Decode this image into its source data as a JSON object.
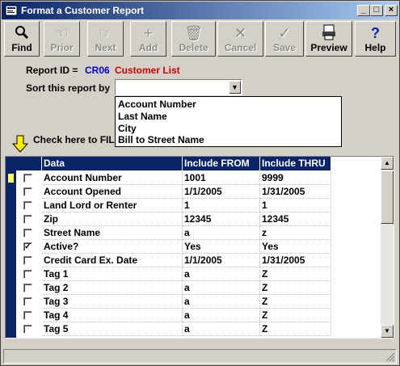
{
  "window": {
    "title": "Format a Customer Report"
  },
  "toolbar": {
    "find": "Find",
    "prior": "Prior",
    "next": "Next",
    "add": "Add",
    "delete": "Delete",
    "cancel": "Cancel",
    "save": "Save",
    "preview": "Preview",
    "help": "Help"
  },
  "report": {
    "id_label": "Report ID =",
    "id_value": "CR06",
    "name": "Customer List"
  },
  "sort": {
    "label": "Sort this report by",
    "selected": "",
    "options": [
      "Account Number",
      "Last Name",
      "City",
      "Bill to Street Name"
    ]
  },
  "filter": {
    "label": "Check here to FIL"
  },
  "grid": {
    "headers": [
      "Data",
      "Include FROM",
      "Include THRU"
    ],
    "rows": [
      {
        "checked": false,
        "data": "Account Number",
        "from": "1001",
        "thru": "9999"
      },
      {
        "checked": false,
        "data": "Account Opened",
        "from": "1/1/2005",
        "thru": "1/31/2005"
      },
      {
        "checked": false,
        "data": "Land Lord or Renter",
        "from": "1",
        "thru": "1"
      },
      {
        "checked": false,
        "data": "Zip",
        "from": "12345",
        "thru": "12345"
      },
      {
        "checked": false,
        "data": "Street Name",
        "from": "a",
        "thru": "z"
      },
      {
        "checked": true,
        "data": "Active?",
        "from": "Yes",
        "thru": "Yes"
      },
      {
        "checked": false,
        "data": "Credit Card Ex. Date",
        "from": "1/1/2005",
        "thru": "1/31/2005"
      },
      {
        "checked": false,
        "data": "Tag 1",
        "from": "a",
        "thru": "Z"
      },
      {
        "checked": false,
        "data": "Tag 2",
        "from": "a",
        "thru": "Z"
      },
      {
        "checked": false,
        "data": "Tag 3",
        "from": "a",
        "thru": "Z"
      },
      {
        "checked": false,
        "data": "Tag 4",
        "from": "a",
        "thru": "Z"
      },
      {
        "checked": false,
        "data": "Tag 5",
        "from": "a",
        "thru": "Z"
      }
    ]
  },
  "colors": {
    "title_start": "#0a246a",
    "title_end": "#a6caf0",
    "report_id": "#0000cc",
    "report_name": "#cc0000",
    "selected_row_marker": "#ffff66"
  }
}
